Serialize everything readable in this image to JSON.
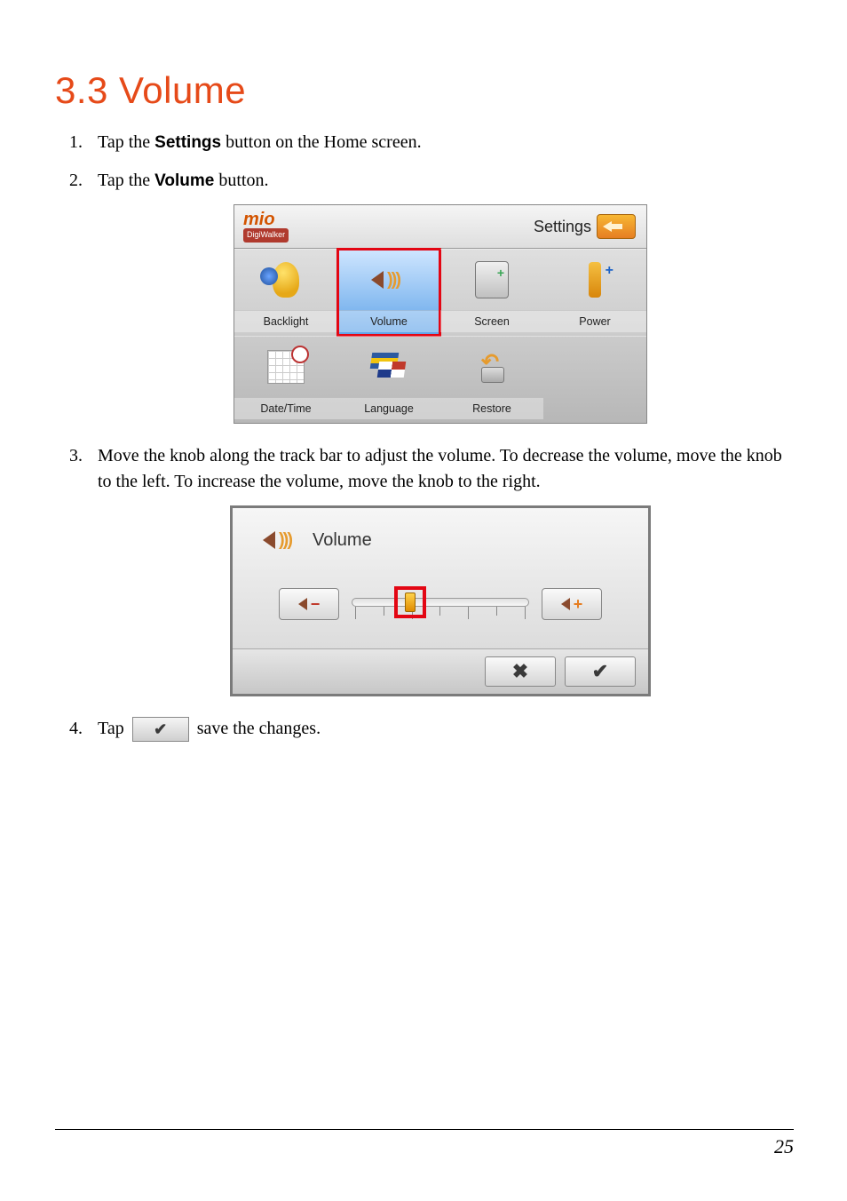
{
  "heading": "3.3   Volume",
  "steps": {
    "s1_a": "Tap the ",
    "s1_b": "Settings",
    "s1_c": " button on the Home screen.",
    "s2_a": "Tap the ",
    "s2_b": "Volume",
    "s2_c": " button.",
    "s3": "Move the knob along the track bar to adjust the volume. To decrease the volume, move the knob to the left. To increase the volume, move the knob to the right.",
    "s4_a": "Tap ",
    "s4_b": " save the changes."
  },
  "settings_screen": {
    "brand_main": "mio",
    "brand_sub": "DigiWalker",
    "title": "Settings",
    "items": [
      {
        "label": "Backlight"
      },
      {
        "label": "Volume"
      },
      {
        "label": "Screen"
      },
      {
        "label": "Power"
      },
      {
        "label": "Date/Time"
      },
      {
        "label": "Language"
      },
      {
        "label": "Restore"
      }
    ]
  },
  "volume_screen": {
    "title": "Volume"
  },
  "page_number": "25"
}
